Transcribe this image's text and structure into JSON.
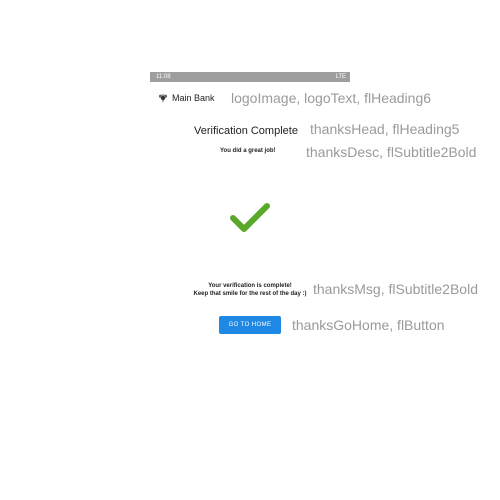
{
  "status_bar": {
    "time": "11:08",
    "right_indicators": "LTE"
  },
  "header": {
    "logo_text": "Main Bank",
    "logo_icon": "bee-icon"
  },
  "labels": {
    "logo": "logoImage, logoText, flHeading6",
    "thanks_head": "thanksHead, flHeading5",
    "thanks_desc": "thanksDesc, flSubtitle2Bold",
    "thanks_msg": "thanksMsg, flSubtitle2Bold",
    "thanks_home": "thanksGoHome, flButton"
  },
  "content": {
    "heading": "Verification Complete",
    "description": "You did a great job!",
    "message_line1": "Your verification is complete!",
    "message_line2": "Keep that smile for the rest of the day :)",
    "button_label": "GO TO HOME"
  },
  "colors": {
    "accent": "#1e88e5",
    "check": "#5aa82a",
    "status_bar": "#9e9e9e",
    "annotation": "#9a9a9a"
  }
}
